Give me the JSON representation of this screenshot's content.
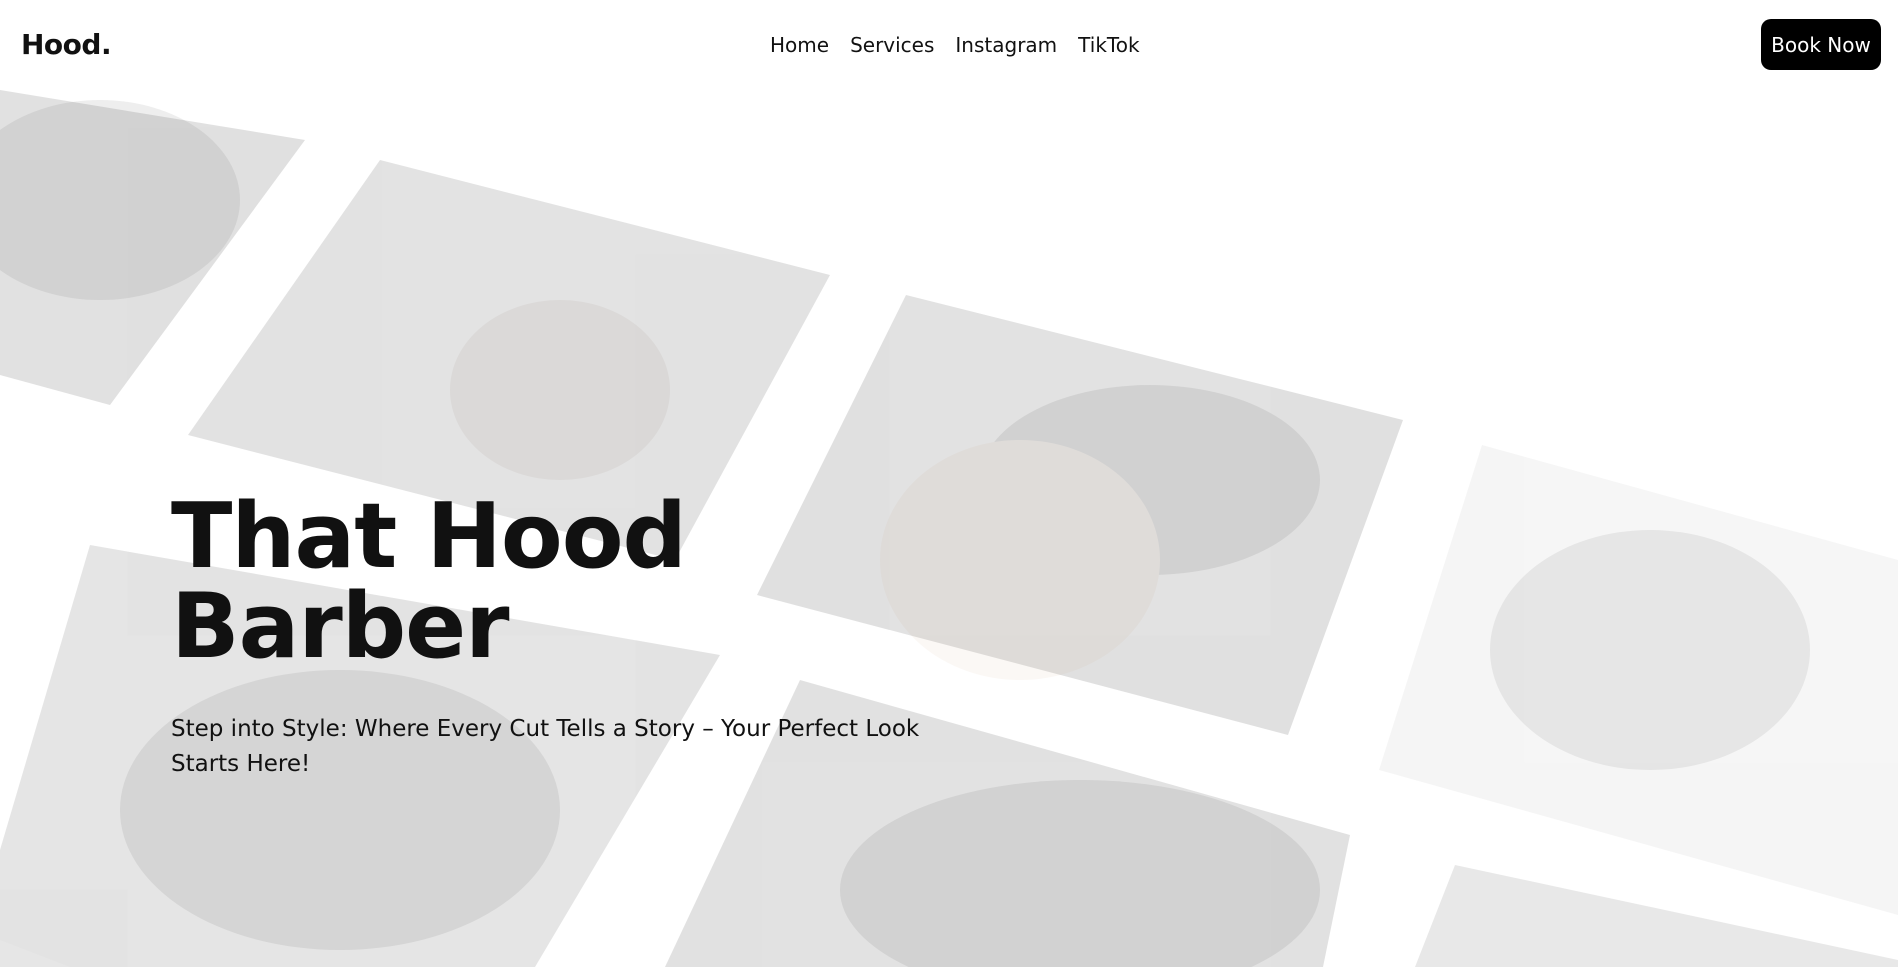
{
  "header": {
    "logo": "Hood.",
    "nav": [
      "Home",
      "Services",
      "Instagram",
      "TikTok"
    ],
    "cta_label": "Book Now"
  },
  "hero": {
    "title": "That Hood Barber",
    "subtitle": "Step into Style: Where Every Cut Tells a Story – Your Perfect Look Starts Here!"
  },
  "colors": {
    "background": "#ffffff",
    "text": "#111111",
    "button_bg": "#000000",
    "button_text": "#ffffff"
  },
  "collage": {
    "description_icons": [
      "haircut-photo"
    ]
  }
}
